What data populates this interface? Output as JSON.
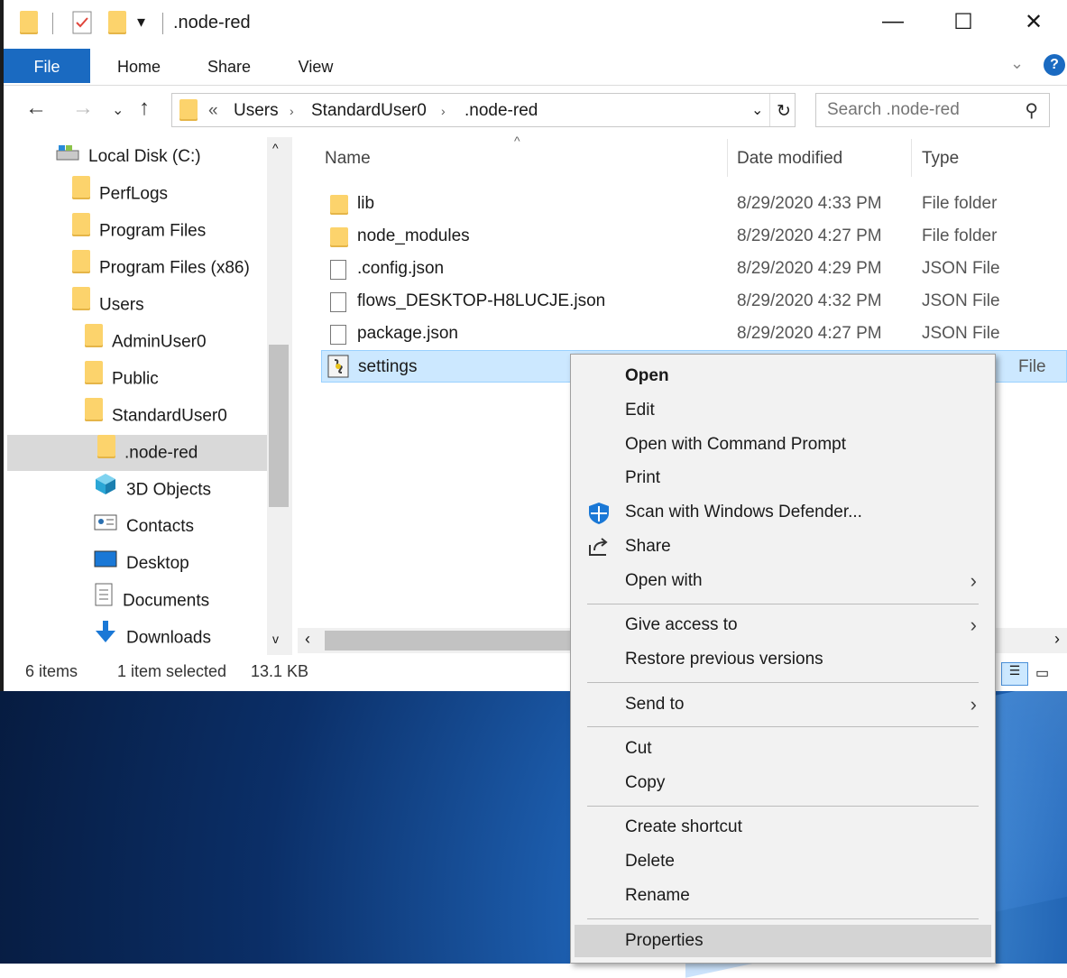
{
  "window": {
    "title": ".node-red"
  },
  "ribbon": {
    "tabs": [
      "File",
      "Home",
      "Share",
      "View"
    ],
    "help": "?"
  },
  "address": {
    "overflow": "«",
    "crumbs": [
      "Users",
      "StandardUser0",
      ".node-red"
    ]
  },
  "search": {
    "placeholder": "Search .node-red"
  },
  "nav": {
    "items": [
      {
        "label": "Local Disk (C:)",
        "icon": "drive-icon"
      },
      {
        "label": "PerfLogs",
        "icon": "folder-icon"
      },
      {
        "label": "Program Files",
        "icon": "folder-icon"
      },
      {
        "label": "Program Files (x86)",
        "icon": "folder-icon"
      },
      {
        "label": "Users",
        "icon": "folder-icon"
      },
      {
        "label": "AdminUser0",
        "icon": "folder-icon"
      },
      {
        "label": "Public",
        "icon": "folder-icon"
      },
      {
        "label": "StandardUser0",
        "icon": "folder-icon"
      },
      {
        "label": ".node-red",
        "icon": "folder-icon"
      },
      {
        "label": "3D Objects",
        "icon": "cube-icon"
      },
      {
        "label": "Contacts",
        "icon": "contacts-icon"
      },
      {
        "label": "Desktop",
        "icon": "desktop-icon"
      },
      {
        "label": "Documents",
        "icon": "documents-icon"
      },
      {
        "label": "Downloads",
        "icon": "download-icon"
      }
    ]
  },
  "columns": {
    "name": "Name",
    "date": "Date modified",
    "type": "Type"
  },
  "files": [
    {
      "name": "lib",
      "date": "8/29/2020 4:33 PM",
      "type": "File folder",
      "icon": "folder-icon"
    },
    {
      "name": "node_modules",
      "date": "8/29/2020 4:27 PM",
      "type": "File folder",
      "icon": "folder-icon"
    },
    {
      "name": ".config.json",
      "date": "8/29/2020 4:29 PM",
      "type": "JSON File",
      "icon": "file-icon"
    },
    {
      "name": "flows_DESKTOP-H8LUCJE.json",
      "date": "8/29/2020 4:32 PM",
      "type": "JSON File",
      "icon": "file-icon"
    },
    {
      "name": "package.json",
      "date": "8/29/2020 4:27 PM",
      "type": "JSON File",
      "icon": "file-icon"
    },
    {
      "name": "settings",
      "date": "",
      "type": "File",
      "icon": "script-icon"
    }
  ],
  "status": {
    "count": "6 items",
    "selected": "1 item selected",
    "size": "13.1 KB"
  },
  "context_menu": {
    "open": "Open",
    "edit": "Edit",
    "open_cmd": "Open with Command Prompt",
    "print": "Print",
    "scan": "Scan with Windows Defender...",
    "share": "Share",
    "open_with": "Open with",
    "give_access": "Give access to",
    "restore": "Restore previous versions",
    "send_to": "Send to",
    "cut": "Cut",
    "copy": "Copy",
    "create_shortcut": "Create shortcut",
    "delete": "Delete",
    "rename": "Rename",
    "properties": "Properties"
  }
}
